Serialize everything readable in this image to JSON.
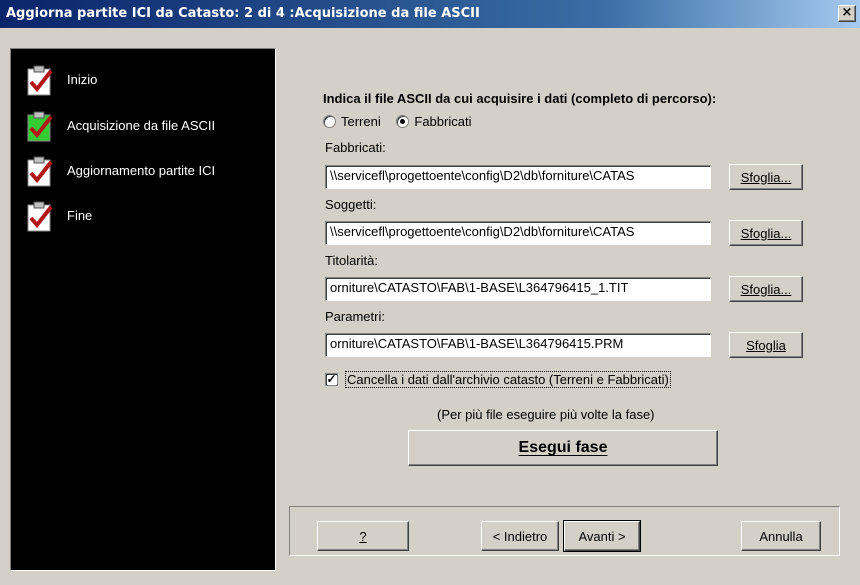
{
  "window": {
    "title": "Aggiorna partite ICI da Catasto: 2 di 4 :Acquisizione da file ASCII",
    "close_label": "×"
  },
  "steps": [
    {
      "label": "Inizio",
      "status": "done",
      "check_color": "#b01818",
      "box_color": "#ffffff"
    },
    {
      "label": "Acquisizione da file ASCII",
      "status": "current",
      "check_color": "#b01818",
      "box_color": "#33cc33"
    },
    {
      "label": "Aggiornamento partite ICI",
      "status": "pending",
      "check_color": "#b01818",
      "box_color": "#ffffff"
    },
    {
      "label": "Fine",
      "status": "pending",
      "check_color": "#b01818",
      "box_color": "#ffffff"
    }
  ],
  "form": {
    "heading": "Indica il file ASCII da cui acquisire i dati (completo di percorso):",
    "radio_terreni": "Terreni",
    "radio_fabbricati": "Fabbricati",
    "selected_radio": "Fabbricati",
    "fields": [
      {
        "label": "Fabbricati:",
        "value": "\\\\servicefl\\progettoente\\config\\D2\\db\\forniture\\CATAS",
        "button": "Sfoglia..."
      },
      {
        "label": "Soggetti:",
        "value": "\\\\servicefl\\progettoente\\config\\D2\\db\\forniture\\CATAS",
        "button": "Sfoglia..."
      },
      {
        "label": "Titolarità:",
        "value": "orniture\\CATASTO\\FAB\\1-BASE\\L364796415_1.TIT",
        "button": "Sfoglia..."
      },
      {
        "label": "Parametri:",
        "value": "orniture\\CATASTO\\FAB\\1-BASE\\L364796415.PRM",
        "button": "Sfoglia"
      }
    ],
    "checkbox_label": "Cancella i dati dall'archivio catasto (Terreni e Fabbricati)",
    "checkbox_checked": true,
    "note": "(Per più file eseguire più volte la fase)",
    "execute_label": "Esegui fase"
  },
  "footer": {
    "help_label": "?",
    "back_label": "< Indietro",
    "next_label": "Avanti >",
    "cancel_label": "Annulla"
  }
}
